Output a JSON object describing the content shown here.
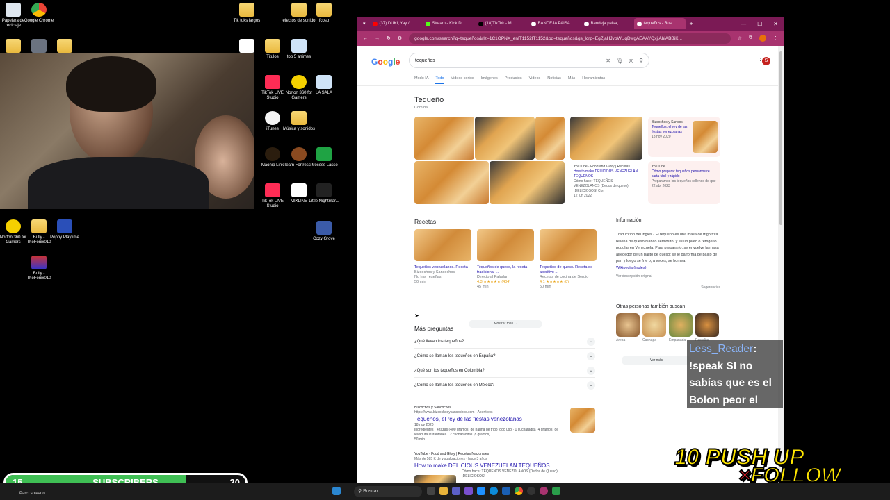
{
  "desktop": {
    "icons": [
      {
        "label": "Papelera de reciclaje",
        "kind": "recycle"
      },
      {
        "label": "Google Chrome",
        "kind": "chrome"
      },
      {
        "label": "Tik toks largos",
        "kind": "folder"
      },
      {
        "label": "efectos de sonido",
        "kind": "folder"
      },
      {
        "label": "fcoso",
        "kind": "folder"
      },
      {
        "label": "Titulos",
        "kind": "folder"
      },
      {
        "label": "top 5 animes",
        "kind": "file"
      },
      {
        "label": "TikTok LIVE Studio",
        "kind": "tiktok"
      },
      {
        "label": "Norton 360 for Gamers",
        "kind": "norton"
      },
      {
        "label": "LA SALA",
        "kind": "file"
      },
      {
        "label": "iTunes",
        "kind": "itunes"
      },
      {
        "label": "Música y sonidos",
        "kind": "folder"
      },
      {
        "label": "Maonip Link",
        "kind": "app"
      },
      {
        "label": "Team Fortress...",
        "kind": "app"
      },
      {
        "label": "Process Lasso",
        "kind": "app"
      },
      {
        "label": "TikTok LIVE Studio",
        "kind": "tiktok"
      },
      {
        "label": "MIXLINE",
        "kind": "app"
      },
      {
        "label": "Little Nightmar...",
        "kind": "app"
      },
      {
        "label": "Cozy Grove",
        "kind": "app"
      },
      {
        "label": "Norton 360 for Gamers",
        "kind": "norton"
      },
      {
        "label": "Bully - TheFenix010",
        "kind": "folder"
      },
      {
        "label": "Poppy Playtime",
        "kind": "app"
      },
      {
        "label": "Bully - TheFenix010",
        "kind": "app"
      }
    ]
  },
  "browser": {
    "tabs": [
      {
        "label": "(37) DUKI, Yay /",
        "color": "#ff0000"
      },
      {
        "label": "Stream - Kick D",
        "color": "#53fc18"
      },
      {
        "label": "(18)TikTok - M",
        "color": "#000000"
      },
      {
        "label": "BANDEJA PAISA",
        "color": "#ffffff"
      },
      {
        "label": "Bandeja paisa,",
        "color": "#ffffff"
      },
      {
        "label": "tequeños - Bus",
        "color": "#ffffff"
      }
    ],
    "url": "google.com/search?q=tequeños&rlz=1C1OPNX_enIT1152IT1152&oq=tequeños&gs_lcrp=EgZjaHJvbWUqDwgAEAAYQxjjAhiABBiK...",
    "accent": "#a8336f"
  },
  "google": {
    "logo": "Google",
    "query": "tequeños",
    "tabs": [
      "Modo IA",
      "Todo",
      "Videos cortos",
      "Imágenes",
      "Productos",
      "Videos",
      "Noticias",
      "Más",
      "Herramientas"
    ],
    "active_tab": "Todo",
    "avatar": "S",
    "kp_title": "Tequeño",
    "kp_sub": "Comida",
    "card1": {
      "source": "Bizcochos y Sancos",
      "text": "Tequeños, el rey de las fiestas venezolanas",
      "date": "18 nov 2020"
    },
    "card2": {
      "source": "YouTube · Food and Glory | Recetas",
      "text": "How to make DELICIOUS VENEZUELAN TEQUEÑOS",
      "desc": "Cómo hacer TEQUEÑOS VENEZOLANOS (Dedos de queso) ¡DELICIOSOS! Con",
      "date": "12 jun 2022"
    },
    "card3": {
      "source": "YouTube",
      "text": "Cómo preparar tequeños peruanos re carta fácil y rápido",
      "desc": "Preparamos los tequeños rellenos de que",
      "date": "22 abr 2023"
    },
    "recipes_h": "Recetas",
    "recipes": [
      {
        "title": "Tequeños venezolanos. Receta",
        "source": "Bizcochos y Sancochos",
        "rating": "No hay reseñas",
        "time": "50 min"
      },
      {
        "title": "Tequeños de queso, la receta tradicional ...",
        "source": "Directo al Paladar",
        "rating": "4,3 ★★★★★ (404)",
        "time": "45 min"
      },
      {
        "title": "Tequeños de queso. Receta de aperitivo ...",
        "source": "Recetas de cocina de Sergio",
        "rating": "4,1 ★★★★★ (8)",
        "time": "50 min"
      }
    ],
    "show_more": "Mostrar más",
    "faq_h": "Más preguntas",
    "faqs": [
      "¿Qué llevan los tequeños?",
      "¿Cómo se llaman los tequeños en España?",
      "¿Qué son los tequeños en Colombia?",
      "¿Cómo se llaman los tequeños en México?"
    ],
    "info_h": "Información",
    "info_text": "Traducción del inglés - El tequeño es una masa de trigo frita rellena de queso blanco semiduro, y es un plato o refrigerio popular en Venezuela. Para prepararlo, se envuelve la masa alrededor de un palito de queso; se le da forma de palito de pan y luego se fríe o, a veces, se hornea.",
    "info_src": "Wikipedia (inglés)",
    "info_orig": "Ver descripción original",
    "suggestions": "Sugerencias",
    "others_h": "Otras personas también buscan",
    "others": [
      "Arepa",
      "Cachapa",
      "Empanada",
      "Pastelito"
    ],
    "see_more": "Ver más",
    "result1": {
      "site": "Bizcochos y Sancochos",
      "url": "https://www.bizcochosysancochos.com › Aperitivos",
      "title": "Tequeños, el rey de las fiestas venezolanas",
      "date": "18 nov 2020",
      "text": "Ingredientes · 4 tazas (400 gramos) de harina de trigo todo uso · 1 cucharadita (4 gramos) de levadura instantánea · 2 cucharaditas (8 gramos)",
      "time": "50 min"
    },
    "result2": {
      "site": "YouTube · Food and Glory | Recetas Nacionales",
      "url": "Más de 585 K de visualizaciones · hace 3 años",
      "title": "How to make DELICIOUS VENEZUELAN TEQUEÑOS",
      "text": "Cómo hacer TEQUEÑOS VENEZOLANOS (Dedos de Queso) ¡DELICIOSOS!"
    }
  },
  "chat": {
    "user": "Less_Reader",
    "message": ": !speak SI no sabías que es el Bolon peor el patacón o el Encebollado Eso es patrimonio nacional"
  },
  "subscribers": {
    "current": "15",
    "label": "SUBSCRIBERS",
    "goal": "20",
    "progress": 0.75
  },
  "promo": {
    "line1": "10 PUSH UP",
    "x": "×",
    "line2": "FOLLOW"
  },
  "taskbar": {
    "weather": "Parc. soleado",
    "search": "Buscar"
  }
}
